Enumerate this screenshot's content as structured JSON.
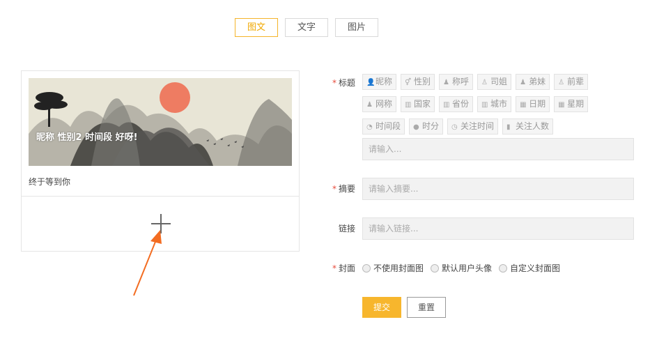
{
  "tabs": [
    {
      "label": "图文",
      "active": true
    },
    {
      "label": "文字",
      "active": false
    },
    {
      "label": "图片",
      "active": false
    }
  ],
  "preview": {
    "banner_text": "昵称 性别2 时间段 好呀!",
    "caption": "终于等到你"
  },
  "form": {
    "title_label": "标题",
    "tags_row1": [
      {
        "icon": "user-icon",
        "glyph": "👤",
        "label": "昵称"
      },
      {
        "icon": "gender-icon",
        "glyph": "⚥",
        "label": "性别"
      },
      {
        "icon": "person-icon",
        "glyph": "♟",
        "label": "称呼"
      },
      {
        "icon": "person-icon",
        "glyph": "♙",
        "label": "司姐"
      },
      {
        "icon": "person-icon",
        "glyph": "♟",
        "label": "弟妹"
      },
      {
        "icon": "person-icon",
        "glyph": "♙",
        "label": "前辈"
      }
    ],
    "tags_row2": [
      {
        "icon": "person-icon",
        "glyph": "♟",
        "label": "网称"
      },
      {
        "icon": "map-icon",
        "glyph": "▥",
        "label": "国家"
      },
      {
        "icon": "map-icon",
        "glyph": "▥",
        "label": "省份"
      },
      {
        "icon": "map-icon",
        "glyph": "▥",
        "label": "城市"
      },
      {
        "icon": "calendar-icon",
        "glyph": "▦",
        "label": "日期"
      },
      {
        "icon": "calendar-icon",
        "glyph": "▦",
        "label": "星期"
      }
    ],
    "tags_row3": [
      {
        "icon": "clock-icon",
        "glyph": "◔",
        "label": "时间段"
      },
      {
        "icon": "dot-icon",
        "glyph": "●",
        "label": "时分"
      },
      {
        "icon": "clock-icon",
        "glyph": "◷",
        "label": "关注时间"
      },
      {
        "icon": "doc-icon",
        "glyph": "▮",
        "label": "关注人数"
      }
    ],
    "title_placeholder": "请输入...",
    "summary_label": "摘要",
    "summary_placeholder": "请输入摘要...",
    "link_label": "链接",
    "link_placeholder": "请输入链接...",
    "cover_label": "封面",
    "cover_options": [
      "不使用封面图",
      "默认用户头像",
      "自定义封面图"
    ],
    "submit_label": "提交",
    "reset_label": "重置"
  },
  "colors": {
    "accent": "#f7b62d",
    "required": "#e74c3c",
    "arrow": "#f36c21"
  }
}
